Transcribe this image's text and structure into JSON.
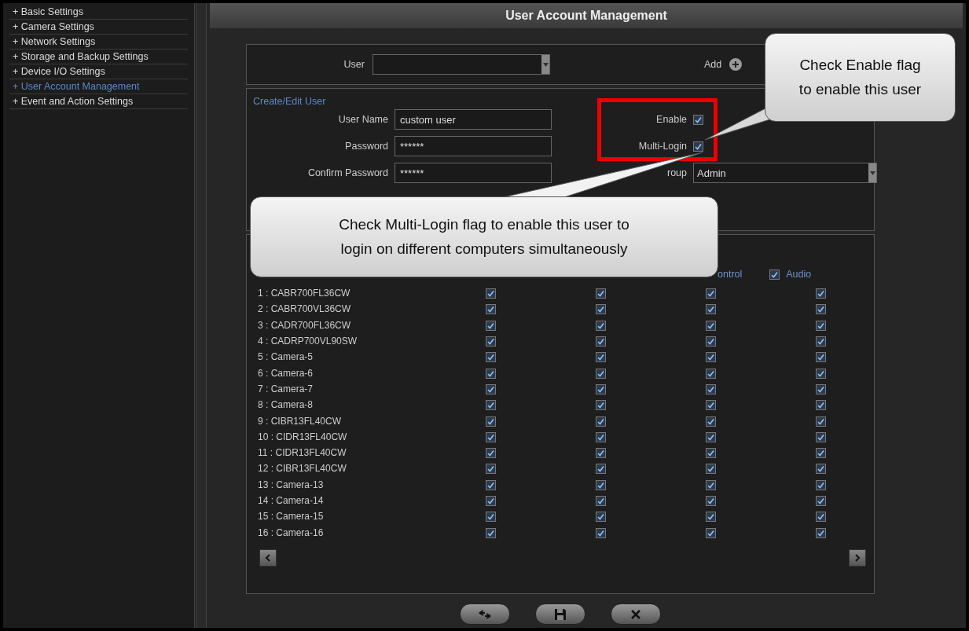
{
  "sidebar": {
    "items": [
      {
        "label": "+ Basic Settings",
        "selected": false
      },
      {
        "label": "+ Camera Settings",
        "selected": false
      },
      {
        "label": "+ Network Settings",
        "selected": false
      },
      {
        "label": "+ Storage and Backup Settings",
        "selected": false
      },
      {
        "label": "+ Device I/O Settings",
        "selected": false
      },
      {
        "label": "+ User Account Management",
        "selected": true
      },
      {
        "label": "+ Event and Action Settings",
        "selected": false
      }
    ]
  },
  "title": "User Account Management",
  "user_bar": {
    "user_label": "User",
    "add_label": "Add"
  },
  "edit_user": {
    "title": "Create/Edit User",
    "fields": [
      {
        "label": "User Name",
        "value": "custom user"
      },
      {
        "label": "Password",
        "value": "******"
      },
      {
        "label": "Confirm Password",
        "value": "******"
      }
    ],
    "flags": [
      {
        "label": "Enable",
        "checked": true
      },
      {
        "label": "Multi-Login",
        "checked": true
      }
    ],
    "group": {
      "label": "roup",
      "value": "Admin"
    }
  },
  "permissions": {
    "columns": [
      {
        "label": "ontrol"
      },
      {
        "label": "Audio",
        "checked": true
      }
    ],
    "rows": [
      {
        "name": "1 : CABR700FL36CW",
        "perms": [
          true,
          true,
          true,
          true
        ]
      },
      {
        "name": "2 : CABR700VL36CW",
        "perms": [
          true,
          true,
          true,
          true
        ]
      },
      {
        "name": "3 : CADR700FL36CW",
        "perms": [
          true,
          true,
          true,
          true
        ]
      },
      {
        "name": "4 : CADRP700VL90SW",
        "perms": [
          true,
          true,
          true,
          true
        ]
      },
      {
        "name": "5 : Camera-5",
        "perms": [
          true,
          true,
          true,
          true
        ]
      },
      {
        "name": "6 : Camera-6",
        "perms": [
          true,
          true,
          true,
          true
        ]
      },
      {
        "name": "7 : Camera-7",
        "perms": [
          true,
          true,
          true,
          true
        ]
      },
      {
        "name": "8 : Camera-8",
        "perms": [
          true,
          true,
          true,
          true
        ]
      },
      {
        "name": "9 : CIBR13FL40CW",
        "perms": [
          true,
          true,
          true,
          true
        ]
      },
      {
        "name": "10 : CIDR13FL40CW",
        "perms": [
          true,
          true,
          true,
          true
        ]
      },
      {
        "name": "11 : CIDR13FL40CW",
        "perms": [
          true,
          true,
          true,
          true
        ]
      },
      {
        "name": "12 : CIBR13FL40CW",
        "perms": [
          true,
          true,
          true,
          true
        ]
      },
      {
        "name": "13 : Camera-13",
        "perms": [
          true,
          true,
          true,
          true
        ]
      },
      {
        "name": "14 : Camera-14",
        "perms": [
          true,
          true,
          true,
          true
        ]
      },
      {
        "name": "15 : Camera-15",
        "perms": [
          true,
          true,
          true,
          true
        ]
      },
      {
        "name": "16 : Camera-16",
        "perms": [
          true,
          true,
          true,
          true
        ]
      }
    ]
  },
  "callouts": [
    {
      "lines": [
        "Check Enable flag",
        "to enable this user"
      ]
    },
    {
      "lines": [
        "Check Multi-Login flag to enable this user to",
        "login on different computers simultaneously"
      ]
    }
  ]
}
